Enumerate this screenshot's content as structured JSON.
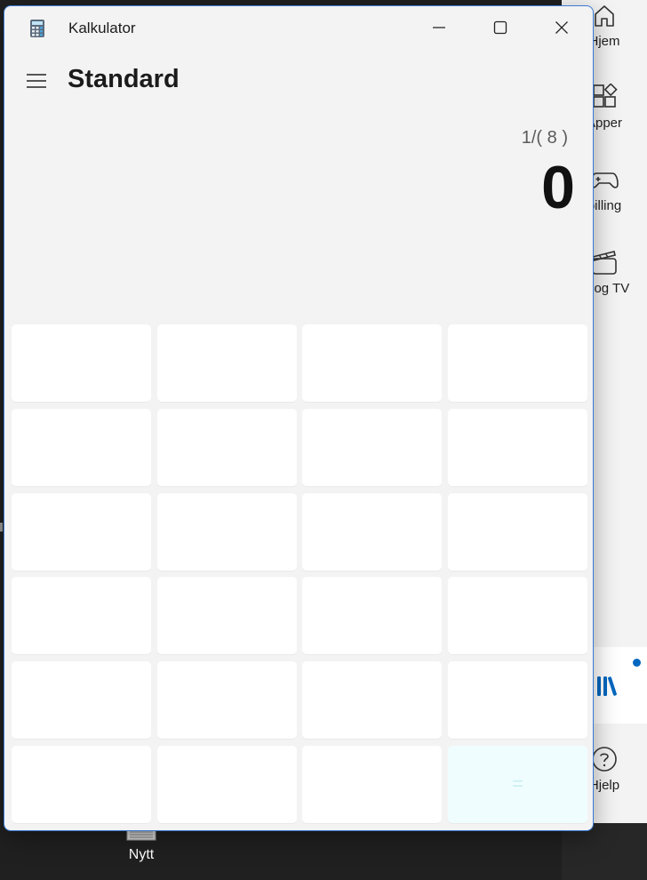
{
  "window": {
    "app_title": "Kalkulator",
    "icon": "calculator-icon"
  },
  "header": {
    "menu_icon": "hamburger-icon",
    "mode": "Standard"
  },
  "display": {
    "expression": "1/( 8 )",
    "value": "0"
  },
  "keypad": {
    "equals_label": "="
  },
  "store_sidebar": {
    "items": [
      {
        "label": "Hjem",
        "icon": "home-icon"
      },
      {
        "label": "Apper",
        "icon": "apps-icon"
      },
      {
        "label": "pilling",
        "icon": "gamepad-icon"
      },
      {
        "label": "m og TV",
        "icon": "film-icon"
      }
    ],
    "library_icon": "library-icon",
    "help": {
      "label": "Hjelp",
      "icon": "help-icon"
    }
  },
  "desktop": {
    "icon_label": "Nytt"
  },
  "colors": {
    "window_bg": "#f3f3f3",
    "key_bg": "#ffffff",
    "accent": "#0067c0",
    "window_border": "#3a7bd5"
  }
}
